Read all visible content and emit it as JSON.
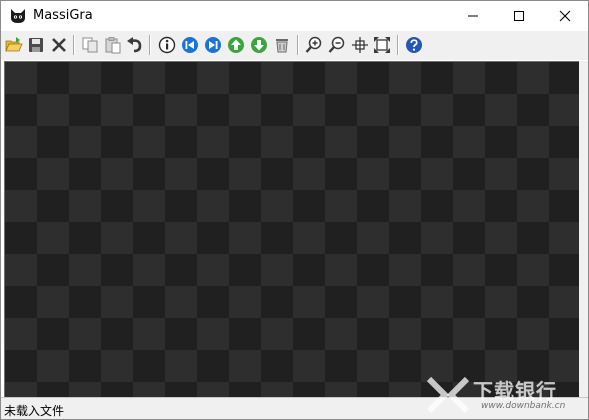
{
  "window": {
    "title": "MassiGra",
    "app_icon": "cat-icon",
    "controls": [
      "minimize-icon",
      "maximize-icon",
      "close-icon"
    ]
  },
  "toolbar": {
    "buttons": [
      {
        "name": "open",
        "icon": "open-folder-icon"
      },
      {
        "name": "save",
        "icon": "save-disk-icon"
      },
      {
        "name": "close-file",
        "icon": "x-icon"
      },
      {
        "name": "copy",
        "icon": "copy-icon"
      },
      {
        "name": "paste",
        "icon": "paste-icon"
      },
      {
        "name": "undo",
        "icon": "undo-icon"
      },
      {
        "name": "info",
        "icon": "info-icon"
      },
      {
        "name": "first",
        "icon": "skip-back-icon"
      },
      {
        "name": "last",
        "icon": "skip-forward-icon"
      },
      {
        "name": "previous",
        "icon": "arrow-up-icon"
      },
      {
        "name": "next",
        "icon": "arrow-down-icon"
      },
      {
        "name": "delete",
        "icon": "trash-icon"
      },
      {
        "name": "zoom-in",
        "icon": "zoom-in-icon"
      },
      {
        "name": "zoom-out",
        "icon": "zoom-out-icon"
      },
      {
        "name": "actual-size",
        "icon": "actual-size-icon"
      },
      {
        "name": "fit-window",
        "icon": "fit-window-icon"
      },
      {
        "name": "help",
        "icon": "help-icon"
      }
    ],
    "colors": {
      "nav_blue": "#1a73d9",
      "nav_green": "#3aa53a",
      "help_blue": "#2456b4"
    }
  },
  "canvas": {
    "pattern": "checkerboard",
    "colors": {
      "light": "#2e2e2e",
      "dark": "#202020"
    }
  },
  "statusbar": {
    "text": "未载入文件"
  },
  "watermark": {
    "main": "下载银行",
    "sub": "www.downbank.cn"
  }
}
